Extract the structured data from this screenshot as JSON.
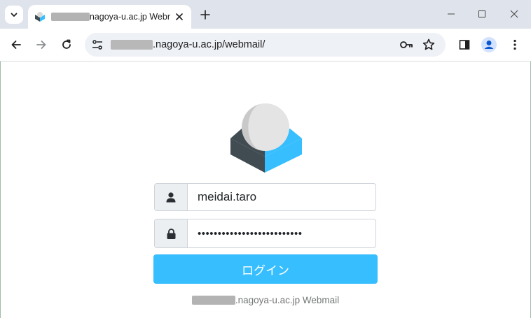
{
  "browser": {
    "tab": {
      "title_suffix": "nagoya-u.ac.jp Webr",
      "close_icon": "close-icon"
    },
    "address_bar": {
      "url_suffix": ".nagoya-u.ac.jp/webmail/"
    },
    "icons": [
      "tab-search-icon",
      "roundcube-favicon",
      "close-icon",
      "new-tab-icon",
      "minimize-icon",
      "maximize-icon",
      "window-close-icon",
      "back-icon",
      "forward-icon",
      "reload-icon",
      "site-settings-icon",
      "password-key-icon",
      "bookmark-star-icon",
      "side-panel-icon",
      "profile-icon",
      "menu-icon"
    ]
  },
  "login": {
    "username_value": "meidai.taro",
    "password_value": "••••••••••••••••••••••••••",
    "submit_label": "ログイン",
    "footer_suffix": ".nagoya-u.ac.jp Webmail"
  },
  "colors": {
    "accent": "#37beff",
    "logo_dark": "#404b52",
    "logo_blue": "#37beff",
    "logo_ball": "#d9d9d9"
  }
}
